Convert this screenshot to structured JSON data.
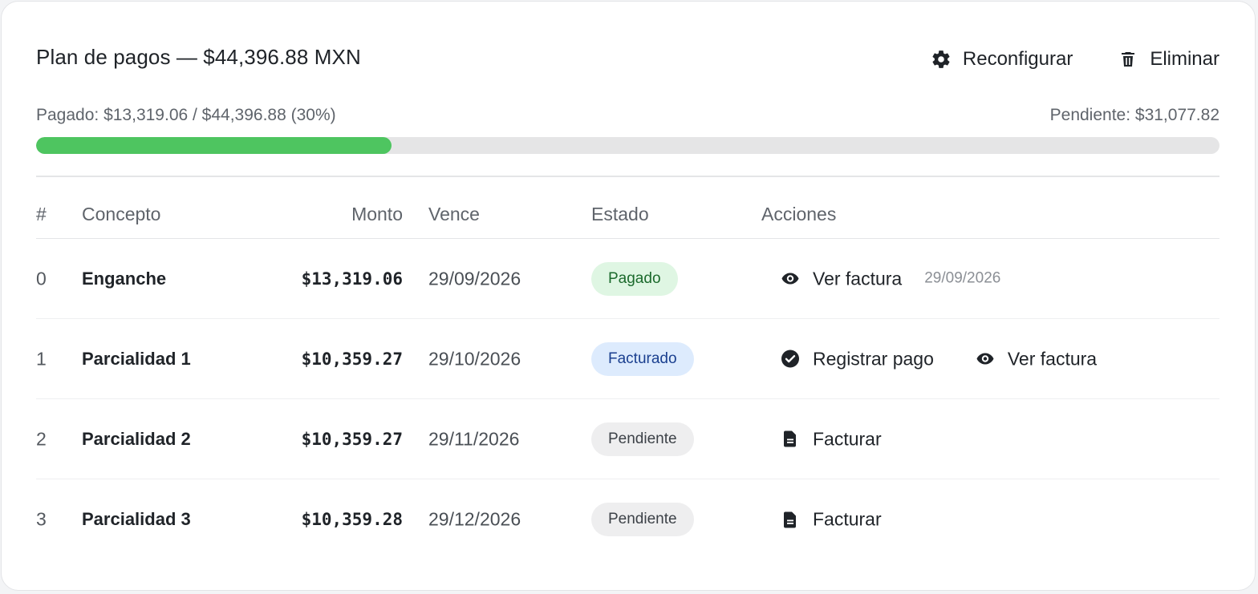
{
  "header": {
    "title": "Plan de pagos — $44,396.88 MXN",
    "reconfigure_label": "Reconfigurar",
    "delete_label": "Eliminar"
  },
  "progress": {
    "paid_label": "Pagado: $13,319.06 / $44,396.88 (30%)",
    "pending_label": "Pendiente: $31,077.82",
    "percent": 30,
    "fill_color": "#4ec560"
  },
  "table": {
    "headers": {
      "num": "#",
      "concept": "Concepto",
      "amount": "Monto",
      "due": "Vence",
      "status": "Estado",
      "actions": "Acciones"
    },
    "rows": [
      {
        "num": "0",
        "concept": "Enganche",
        "amount": "$13,319.06",
        "due": "29/09/2026",
        "status": "Pagado",
        "status_kind": "paid",
        "actions": [
          {
            "label": "Ver factura",
            "icon": "eye-icon"
          }
        ],
        "action_date": "29/09/2026"
      },
      {
        "num": "1",
        "concept": "Parcialidad 1",
        "amount": "$10,359.27",
        "due": "29/10/2026",
        "status": "Facturado",
        "status_kind": "billed",
        "actions": [
          {
            "label": "Registrar pago",
            "icon": "check-circle-icon"
          },
          {
            "label": "Ver factura",
            "icon": "eye-icon"
          }
        ]
      },
      {
        "num": "2",
        "concept": "Parcialidad 2",
        "amount": "$10,359.27",
        "due": "29/11/2026",
        "status": "Pendiente",
        "status_kind": "pending",
        "actions": [
          {
            "label": "Facturar",
            "icon": "file-icon"
          }
        ]
      },
      {
        "num": "3",
        "concept": "Parcialidad 3",
        "amount": "$10,359.28",
        "due": "29/12/2026",
        "status": "Pendiente",
        "status_kind": "pending",
        "actions": [
          {
            "label": "Facturar",
            "icon": "file-icon"
          }
        ]
      }
    ]
  },
  "icons": {
    "reconfigure": "gear-icon",
    "delete": "trash-icon"
  }
}
